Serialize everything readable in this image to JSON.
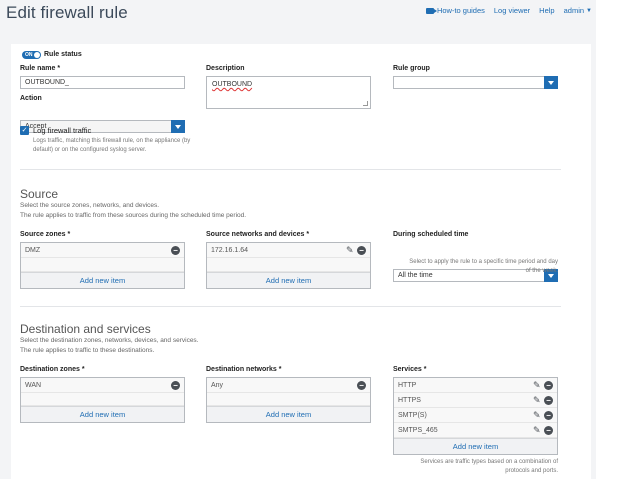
{
  "page": {
    "title": "Edit firewall rule"
  },
  "topnav": {
    "how_to": "How-to guides",
    "log_viewer": "Log viewer",
    "help": "Help",
    "admin": "admin"
  },
  "rule": {
    "status_label": "Rule status",
    "toggle_text": "ON",
    "name_label": "Rule name *",
    "name_value": "OUTBOUND_",
    "description_label": "Description",
    "description_value": "OUTBOUND",
    "group_label": "Rule group",
    "group_value": "",
    "action_label": "Action",
    "action_value": "Accept",
    "log_label": "Log firewall traffic",
    "log_help": "Logs traffic, matching this firewall rule, on the appliance (by default) or on the configured syslog server."
  },
  "source": {
    "title": "Source",
    "desc1": "Select the source zones, networks, and devices.",
    "desc2": "The rule applies to traffic from these sources during the scheduled time period.",
    "zones_label": "Source zones *",
    "zones": [
      "DMZ"
    ],
    "networks_label": "Source networks and devices *",
    "networks": [
      "172.16.1.64"
    ],
    "schedule_label": "During scheduled time",
    "schedule_value": "All the time",
    "schedule_help": "Select to apply the rule to a specific time period and day of the week.",
    "add_label": "Add new item"
  },
  "destination": {
    "title": "Destination and services",
    "desc1": "Select the destination zones, networks, devices, and services.",
    "desc2": "The rule applies to traffic to these destinations.",
    "zones_label": "Destination zones *",
    "zones": [
      "WAN"
    ],
    "networks_label": "Destination networks *",
    "networks": [
      "Any"
    ],
    "services_label": "Services *",
    "services": [
      "HTTP",
      "HTTPS",
      "SMTP(S)",
      "SMTPS_465"
    ],
    "services_help": "Services are traffic types based on a combination of protocols and ports.",
    "add_label": "Add new item"
  }
}
